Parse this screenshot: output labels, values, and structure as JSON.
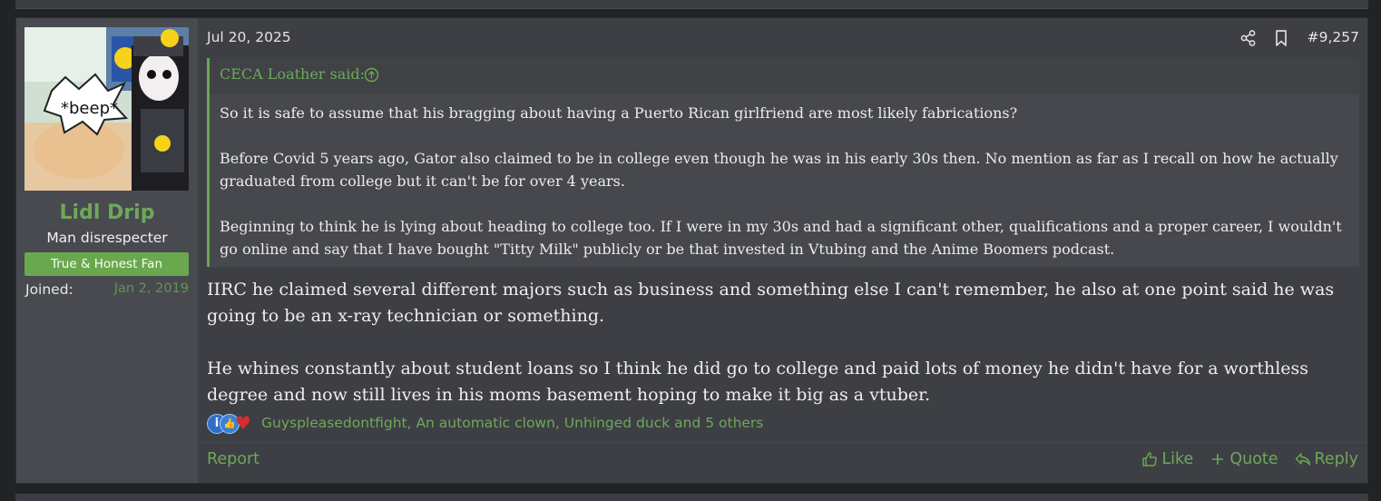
{
  "post": {
    "date": "Jul 20, 2025",
    "number": "#9,257",
    "author": {
      "username": "Lidl Drip",
      "title": "Man disrespecter",
      "banner": "True & Honest Fan",
      "joined_label": "Joined:",
      "joined_date": "Jan 2, 2019",
      "avatar_text": "*beep*"
    },
    "quote": {
      "author": "CECA Loather said:",
      "paragraphs": [
        "So it is safe to assume that his bragging about having a Puerto Rican girlfriend are most likely fabrications?",
        "Before Covid 5 years ago, Gator also claimed to be in college even though he was in his early 30s then. No mention as far as I recall on how he actually graduated from college but it can't be for over 4 years.",
        "Beginning to think he is lying about heading to college too. If I were in my 30s and had a significant other, qualifications and a proper career, I wouldn't go online and say that I have bought \"Titty Milk\" publicly or be that invested in Vtubing and the Anime Boomers podcast."
      ]
    },
    "message": [
      "IIRC he claimed several different majors such as business and something else I can't remember, he also at one point said he was going to be an x-ray technician or something.",
      "He whines constantly about student loans so I think he did go to college and paid lots of money he didn't have for a worthless degree and now still lives in his moms basement hoping to make it big as a vtuber."
    ],
    "reactions": {
      "icons": [
        "info-icon",
        "thumbs-up-icon",
        "heart-icon"
      ],
      "users": "Guyspleasedontfight, An automatic clown, Unhinged duck and 5 others"
    },
    "footer": {
      "report": "Report",
      "like": "Like",
      "quote": "Quote",
      "reply": "Reply"
    }
  },
  "colors": {
    "accent": "#6aa84f",
    "post_bg": "#3d3f44",
    "user_col_bg": "#484a50",
    "page_bg": "#222325"
  }
}
